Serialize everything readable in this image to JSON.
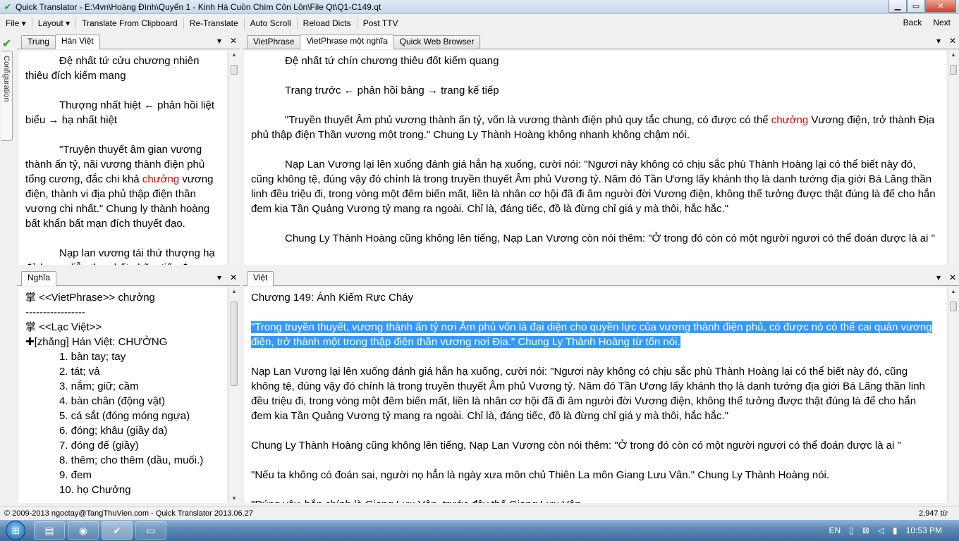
{
  "window": {
    "title": "Quick Translator - E:\\4vn\\Hoàng Đình\\Quyển 1 - Kinh Hà Cuồn Chìm Côn Lôn\\File Qt\\Q1-C149.qt",
    "minimize": "▁",
    "maximize": "▭",
    "close": "✕"
  },
  "menu": {
    "file": "File ▾",
    "layout": "Layout ▾",
    "translate_clipboard": "Translate From Clipboard",
    "retranslate": "Re-Translate",
    "auto_scroll": "Auto Scroll",
    "reload_dicts": "Reload Dicts",
    "post_ttv": "Post TTV",
    "back": "Back",
    "next": "Next"
  },
  "side": {
    "configuration": "Configuration"
  },
  "left_top": {
    "tabs": [
      "Trung",
      "Hán Việt"
    ],
    "paragraphs": [
      {
        "text": "Đệ nhất tứ cửu chương nhiên thiêu đích kiếm mang"
      },
      {
        "text": "Thượng nhất hiệt ← phản hồi liệt biểu → hạ nhất hiệt"
      },
      {
        "before": "\"Truyện thuyết âm gian vương thành ấn tỷ, nãi vương thành điện phủ tổng cương, đắc chi khả ",
        "red": "chưởng",
        "after": " vương điện, thành vi địa phủ thập điện thần vương chi nhất.\" Chung ly thành hoàng bất khẩn bất mạn đích thuyết đạo."
      },
      {
        "text": "Nạp lan vương tái thứ thượng hạ đả lượng liễu tha nhất nhãn, tiếu đạo: \"Nhĩ..."
      }
    ]
  },
  "right_top": {
    "tabs": [
      "VietPhrase",
      "VietPhrase một nghĩa",
      "Quick Web Browser"
    ],
    "paragraphs": [
      {
        "text": "Đệ nhất tứ chín chương thiêu đốt kiếm quang"
      },
      {
        "text": "Trang trước ← phản hồi bảng → trang kế tiếp"
      },
      {
        "before": "\"Truyền thuyết Âm phủ vương thành ấn tỷ, vốn là vương thành điện phủ quy tắc chung, có được có thể ",
        "red": "chưởng",
        "after": " Vương điện, trở thành Địa phủ thập điện Thần vương một trong.\" Chung Ly Thành Hoàng không nhanh không chậm nói."
      },
      {
        "text": "Nạp Lan Vương lại lên xuống đánh giá hắn hạ xuống, cười nói: \"Ngươi này không có chịu sắc phù Thành Hoàng lại có thể biết này đó, cũng không tệ, đúng vậy đó chính là trong truyền thuyết Âm phủ Vương tỷ. Năm đó Tần Ương lấy khánh thọ là danh tướng địa giới Bá Lăng thần linh đều triệu đi, trong vòng một đêm biến mất, liền là nhân cơ hội đã đi âm người đời Vương điện, không thể tưởng được thật đúng là để cho hắn đem kia Tần Quảng Vương tỷ mang ra ngoài. Chỉ là, đáng tiếc, đồ là đừng chỉ giá y mà thôi, hắc hắc.\""
      },
      {
        "text": "Chung Ly Thành Hoàng cũng không lên tiếng, Nạp Lan Vương còn nói thêm: \"Ở trong đó còn có một người ngươi có thể đoán được là ai \""
      }
    ]
  },
  "left_bottom": {
    "tabs": [
      "Nghĩa"
    ],
    "lines": [
      {
        "text": "掌 <<VietPhrase>> chưởng",
        "num": false
      },
      {
        "text": "-----------------",
        "num": false
      },
      {
        "text": "掌 <<Lạc Việt>>",
        "num": false
      },
      {
        "text": "✚[zhǎng] Hán Việt: CHƯỞNG",
        "num": false
      },
      {
        "text": "1. bàn tay; tay",
        "num": true
      },
      {
        "text": "2. tát; vả",
        "num": true
      },
      {
        "text": "3. nắm; giữ; cầm",
        "num": true
      },
      {
        "text": "4. bàn chân (động vật)",
        "num": true
      },
      {
        "text": "5. cá sắt (đóng móng ngựa)",
        "num": true
      },
      {
        "text": "6. đóng; khâu (giầy da)",
        "num": true
      },
      {
        "text": "7. đóng đế (giầy)",
        "num": true
      },
      {
        "text": "8. thêm; cho thêm (dầu, muối.)",
        "num": true
      },
      {
        "text": "9. đem",
        "num": true
      },
      {
        "text": "10. họ Chưởng",
        "num": true
      }
    ]
  },
  "right_bottom": {
    "tabs": [
      "Việt"
    ],
    "paragraphs": [
      {
        "text": "Chương 149: Ánh Kiếm Rực Cháy",
        "hl": false
      },
      {
        "text": "\"Trong truyền thuyết, vương thành ấn tỷ nơi Âm phủ vốn là đại diện cho quyền lực của vương thành điện phủ, có được nó có thể cai quản vương điện, trở thành một trong thập điện thần vương nơi Địa.\" Chung Ly Thành Hoàng từ tốn nói.",
        "hl": true
      },
      {
        "text": "Nạp Lan Vương lại lên xuống đánh giá hắn hạ xuống, cười nói: \"Ngươi này không có chịu sắc phù Thành Hoàng lại có thể biết này đó, cũng không tệ, đúng vậy đó chính là trong truyền thuyết Âm phủ Vương tỷ. Năm đó Tần Ương lấy khánh thọ là danh tướng địa giới Bá Lăng thần linh đều triệu đi, trong vòng một đêm biến mất, liền là nhân cơ hội đã đi âm người đời Vương điện, không thể tưởng được thật đúng là để cho hắn đem kia Tần Quảng Vương tỷ mang ra ngoài. Chỉ là, đáng tiếc, đồ là đừng chỉ giá y mà thôi, hắc hắc.\"",
        "hl": false
      },
      {
        "text": "Chung Ly Thành Hoàng cũng không lên tiếng, Nạp Lan Vương còn nói thêm: \"Ở trong đó còn có một người ngươi có thể đoán được là ai \"",
        "hl": false
      },
      {
        "text": "\"Nếu ta không có đoán sai, người nọ hẳn là ngày xưa môn chủ Thiên La môn Giang Lưu Vân.\" Chung Ly Thành Hoàng nói.",
        "hl": false
      },
      {
        "text": "\"Đúng vậy, hắn chính là Giang Lưu Vân, trước đây thế Giang Lưu Vân...",
        "hl": false
      }
    ]
  },
  "status": {
    "left": "© 2009-2013 ngoctay@TangThuVien.com - Quick Translator 2013.06.27",
    "right": "2,947 từ"
  },
  "taskbar": {
    "lang": "EN",
    "time": "10:53 PM"
  }
}
